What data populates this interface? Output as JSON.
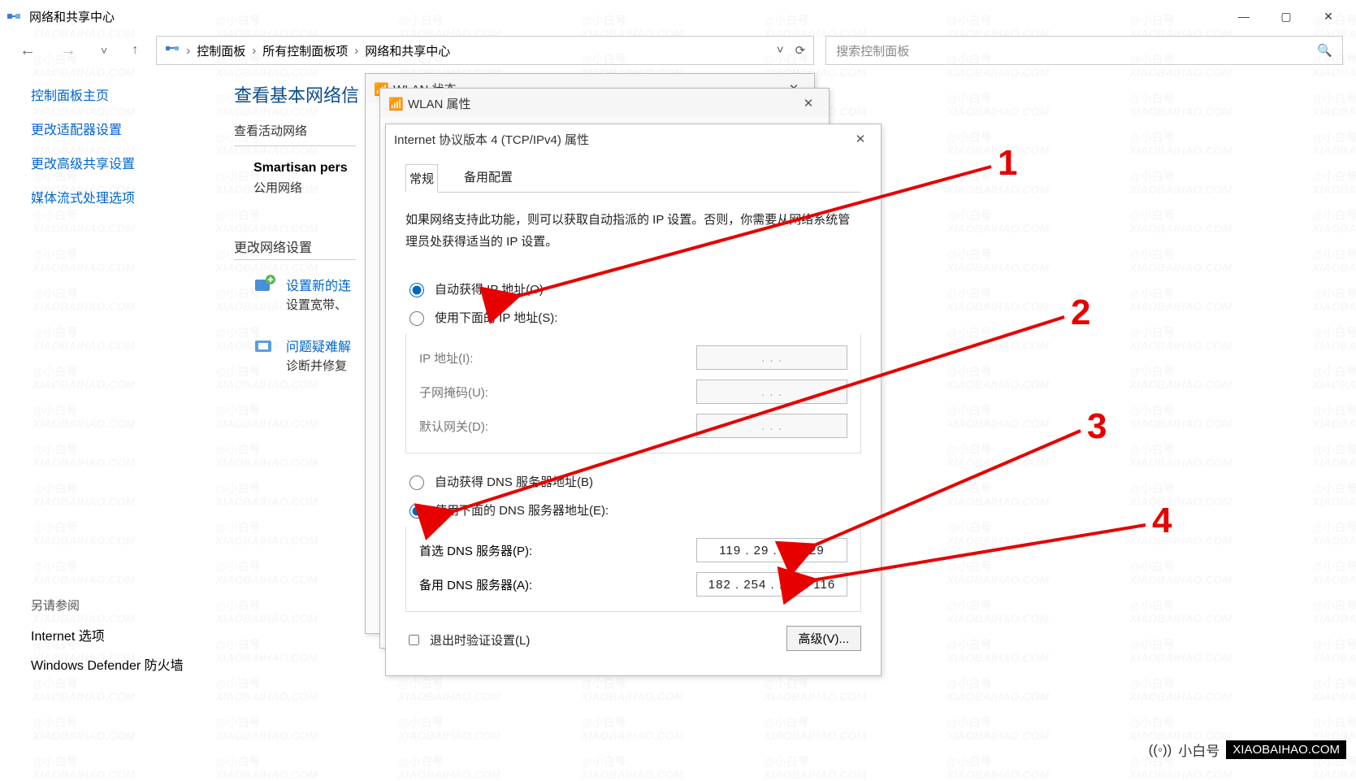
{
  "window_title": "网络和共享中心",
  "win_controls": {
    "min": "—",
    "max": "▢",
    "close": "✕"
  },
  "nav": {
    "back": "←",
    "forward": "→",
    "recent": "˅",
    "up": "↑"
  },
  "breadcrumb": {
    "root_icon": "⬚",
    "item1": "控制面板",
    "item2": "所有控制面板项",
    "item3": "网络和共享中心",
    "chev": "›",
    "dropdown": "˅",
    "refresh": "⟳"
  },
  "search_placeholder": "搜索控制面板",
  "sidebar": {
    "home": "控制面板主页",
    "adapter": "更改适配器设置",
    "sharing": "更改高级共享设置",
    "media": "媒体流式处理选项",
    "see_also": "另请参阅",
    "inet_options": "Internet 选项",
    "defender": "Windows Defender 防火墙"
  },
  "main": {
    "heading": "查看基本网络信",
    "active_net_label": "查看活动网络",
    "network_name": "Smartisan pers",
    "network_type": "公用网络",
    "change_settings_label": "更改网络设置",
    "opt1_title": "设置新的连",
    "opt1_desc": "设置宽带、",
    "opt2_title": "问题疑难解",
    "opt2_desc": "诊断并修复"
  },
  "dlg_status_title": "WLAN 状态",
  "dlg_prop_title": "WLAN 属性",
  "ipv4": {
    "title": "Internet 协议版本 4 (TCP/IPv4) 属性",
    "tab_general": "常规",
    "tab_alt": "备用配置",
    "help": "如果网络支持此功能，则可以获取自动指派的 IP 设置。否则，你需要从网络系统管理员处获得适当的 IP 设置。",
    "auto_ip": "自动获得 IP 地址(O)",
    "manual_ip": "使用下面的 IP 地址(S):",
    "ip_label": "IP 地址(I):",
    "mask_label": "子网掩码(U):",
    "gw_label": "默认网关(D):",
    "auto_dns": "自动获得 DNS 服务器地址(B)",
    "manual_dns": "使用下面的 DNS 服务器地址(E):",
    "dns1_label": "首选 DNS 服务器(P):",
    "dns2_label": "备用 DNS 服务器(A):",
    "dns1_value": "119 . 29 . 29 . 29",
    "dns2_value": "182 . 254 . 116 . 116",
    "dot_placeholder": ".       .       .",
    "validate": "退出时验证设置(L)",
    "advanced": "高级(V)..."
  },
  "annotations": {
    "n1": "1",
    "n2": "2",
    "n3": "3",
    "n4": "4"
  },
  "brand": {
    "icon": "((◦))",
    "name": "小白号",
    "url": "XIAOBAIHAO.COM"
  },
  "watermark": {
    "a": "@小白号",
    "b": "XIAOBAIHAO.COM"
  }
}
